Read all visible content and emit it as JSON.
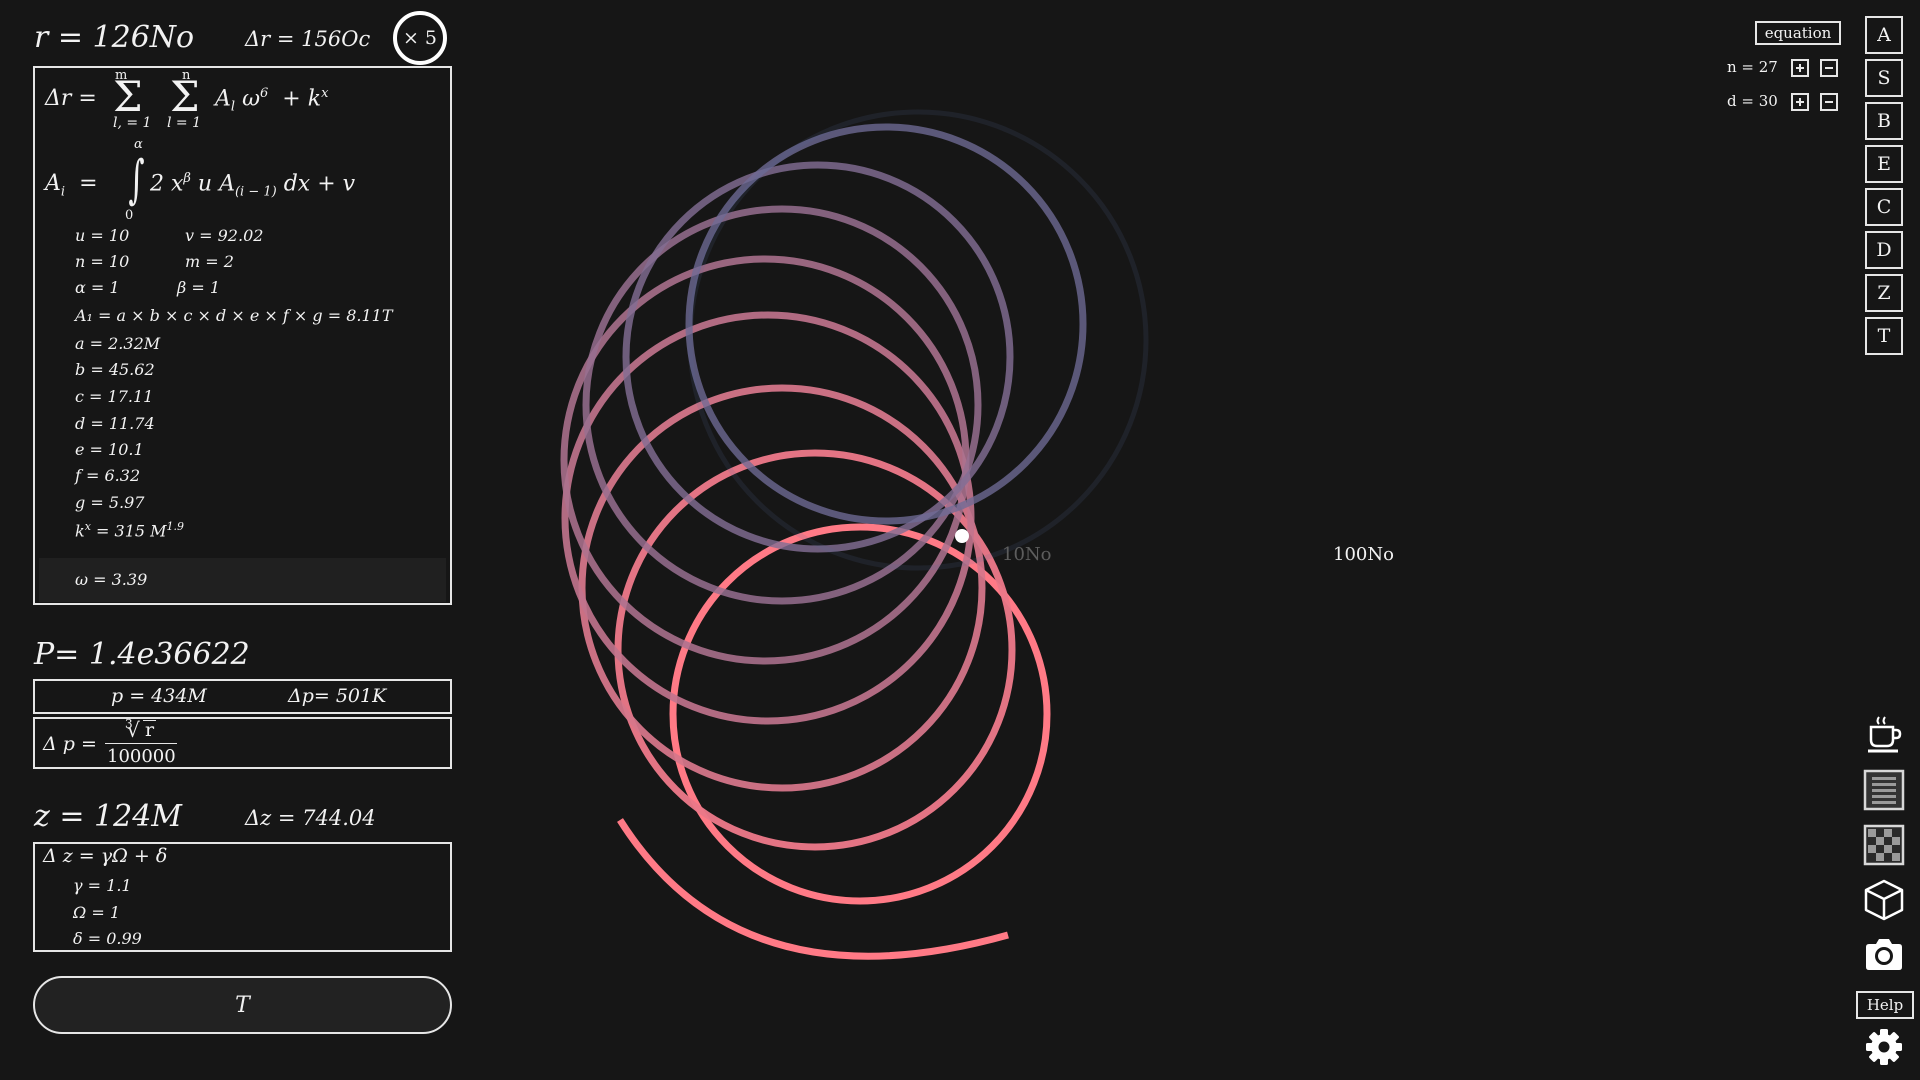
{
  "header": {
    "r_value": "r = 126No",
    "dr_value": "Δr = 156Oc",
    "multiplier": "× 5"
  },
  "formula": {
    "dr_lhs": "Δr =",
    "sum1_top": "m",
    "sum1_bot": "l, = 1",
    "sum2_top": "n",
    "sum2_bot": "l = 1",
    "dr_body": "A",
    "dr_sub": "l",
    "dr_omega": "ω",
    "dr_exp6": "6",
    "dr_plus": "+ k",
    "dr_kexp": "x",
    "ai_lhs": "A",
    "ai_sub": "i",
    "ai_eq": "=",
    "int_top": "α",
    "int_bot": "0",
    "ai_body1": "2 x",
    "ai_beta": "β",
    "ai_body2": "u A",
    "ai_sub2": "(i − 1)",
    "ai_body3": "dx + v",
    "u": "u = 10",
    "v": "v = 92.02",
    "n": "n = 10",
    "m": "m = 2",
    "alpha": "α = 1",
    "beta": "β = 1",
    "a1": "A₁ = a × b × c × d × e × f × g = 8.11T",
    "a": "a = 2.32M",
    "b": "b = 45.62",
    "c": "c = 17.11",
    "d": "d = 11.74",
    "e": "e = 10.1",
    "f": "f = 6.32",
    "g": "g = 5.97",
    "kx_lhs": "k",
    "kx_exp": "x",
    "kx_rhs": "= 315 M",
    "kx_pow": "1.9",
    "omega": "ω = 3.39"
  },
  "power": {
    "p_value": "P= 1.4e36622",
    "p": "p = 434M",
    "dp": "Δp= 501K",
    "dp_lhs": "Δ p =",
    "dp_root_index": "3",
    "dp_num": "r",
    "dp_den": "100000"
  },
  "z": {
    "z_value": "z = 124M",
    "dz_value": "Δz = 744.04",
    "formula": "Δ z = γΩ + δ",
    "gamma": "γ = 1.1",
    "Omega": "Ω = 1",
    "delta": "δ = 0.99"
  },
  "t_button": "T",
  "canvas": {
    "label_inner": "10No",
    "label_outer": "100No",
    "loops": 8,
    "color_start": "#ff7a86",
    "color_end": "#5a6a98"
  },
  "controls": {
    "equation_label": "equation",
    "n_label": "n = 27",
    "d_label": "d = 30",
    "letters": [
      "A",
      "S",
      "B",
      "E",
      "C",
      "D",
      "Z",
      "T"
    ],
    "help_label": "Help"
  }
}
